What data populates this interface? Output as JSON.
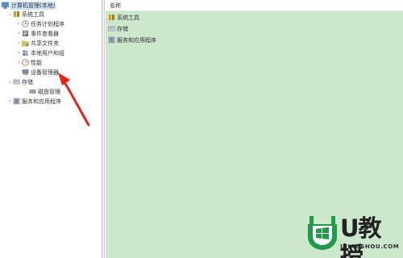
{
  "tree": {
    "root": {
      "label": "计算机管理(本地)"
    },
    "items": [
      {
        "label": "系统工具",
        "expander": "⌄"
      },
      {
        "label": "任务计划程序",
        "expander": "›"
      },
      {
        "label": "事件查看器",
        "expander": "›"
      },
      {
        "label": "共享文件夹",
        "expander": "›"
      },
      {
        "label": "本地用户和组",
        "expander": "›"
      },
      {
        "label": "性能",
        "expander": "›"
      },
      {
        "label": "设备管理器",
        "expander": ""
      },
      {
        "label": "存储",
        "expander": "⌄"
      },
      {
        "label": "磁盘管理",
        "expander": ""
      },
      {
        "label": "服务和应用程序",
        "expander": "›"
      }
    ]
  },
  "list": {
    "column_header": "名称",
    "rows": [
      {
        "label": "系统工具"
      },
      {
        "label": "存储"
      },
      {
        "label": "服务和应用程序"
      }
    ]
  },
  "watermark": {
    "title": "U教授",
    "url": "UJIAOSHOU.COM"
  },
  "colors": {
    "list_background": "#cde7cd",
    "arrow": "#e0251b",
    "selected_row": "#cde3f7"
  }
}
